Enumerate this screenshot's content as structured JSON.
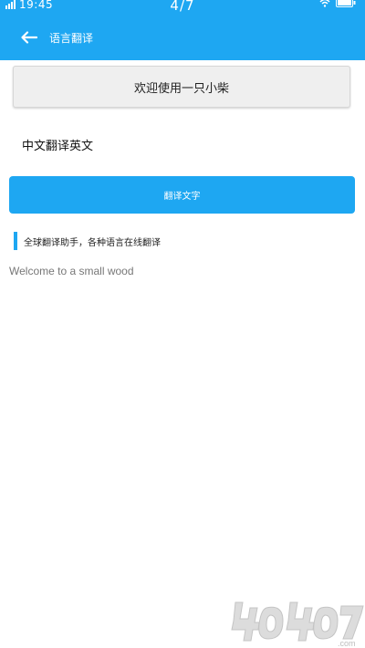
{
  "status_bar": {
    "time": "19:45",
    "page_indicator": "4/7"
  },
  "app_bar": {
    "back_icon": "arrow-left-icon",
    "title": "语言翻译"
  },
  "welcome": {
    "text": "欢迎使用一只小柴"
  },
  "input": {
    "value": "中文翻译英文"
  },
  "translate_button": {
    "label": "翻译文字"
  },
  "tagline": {
    "text": "全球翻译助手，各种语言在线翻译"
  },
  "result": {
    "text": "Welcome to a small wood"
  },
  "watermark": {
    "text": "4O4O7.com"
  },
  "colors": {
    "primary": "#1ea7f2",
    "welcome_bg": "#efefef",
    "result_text": "#777777"
  }
}
